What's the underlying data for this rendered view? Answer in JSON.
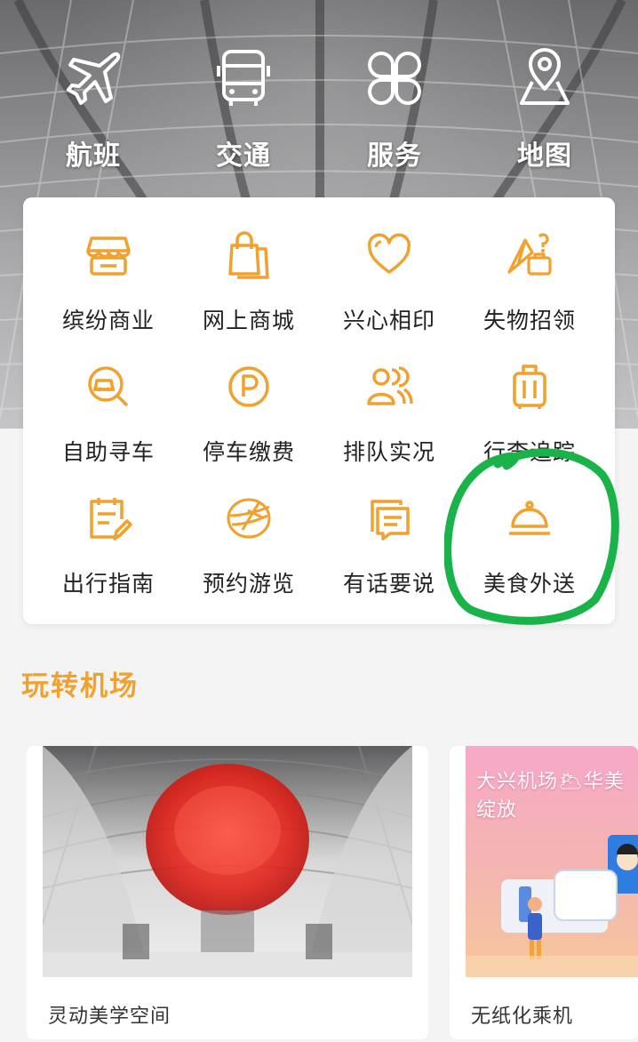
{
  "top_nav": [
    {
      "label": "航班",
      "icon": "airplane-icon"
    },
    {
      "label": "交通",
      "icon": "bus-icon"
    },
    {
      "label": "服务",
      "icon": "clover-grid-icon"
    },
    {
      "label": "地图",
      "icon": "map-pin-icon"
    }
  ],
  "services": [
    {
      "label": "缤纷商业",
      "icon": "store-icon"
    },
    {
      "label": "网上商城",
      "icon": "shopping-bag-icon"
    },
    {
      "label": "兴心相印",
      "icon": "heart-icon"
    },
    {
      "label": "失物招领",
      "icon": "lost-and-found-icon"
    },
    {
      "label": "自助寻车",
      "icon": "find-car-icon"
    },
    {
      "label": "停车缴费",
      "icon": "parking-icon"
    },
    {
      "label": "排队实况",
      "icon": "queue-people-icon"
    },
    {
      "label": "行李追踪",
      "icon": "luggage-icon"
    },
    {
      "label": "出行指南",
      "icon": "guide-clipboard-icon"
    },
    {
      "label": "预约游览",
      "icon": "tour-plane-icon"
    },
    {
      "label": "有话要说",
      "icon": "feedback-icon"
    },
    {
      "label": "美食外送",
      "icon": "food-cloche-icon"
    }
  ],
  "section": {
    "title": "玩转机场"
  },
  "features": [
    {
      "caption": "灵动美学空间",
      "image": "red-sculpture-photo"
    },
    {
      "caption": "无纸化乘机",
      "image": "paperless-boarding-illustration",
      "banner": "大兴机场🌥华美绽放"
    }
  ],
  "colors": {
    "accent": "#f0a12e",
    "annotation": "#19b34a",
    "card_bg": "#ffffff",
    "page_bg": "#f4f4f4"
  }
}
